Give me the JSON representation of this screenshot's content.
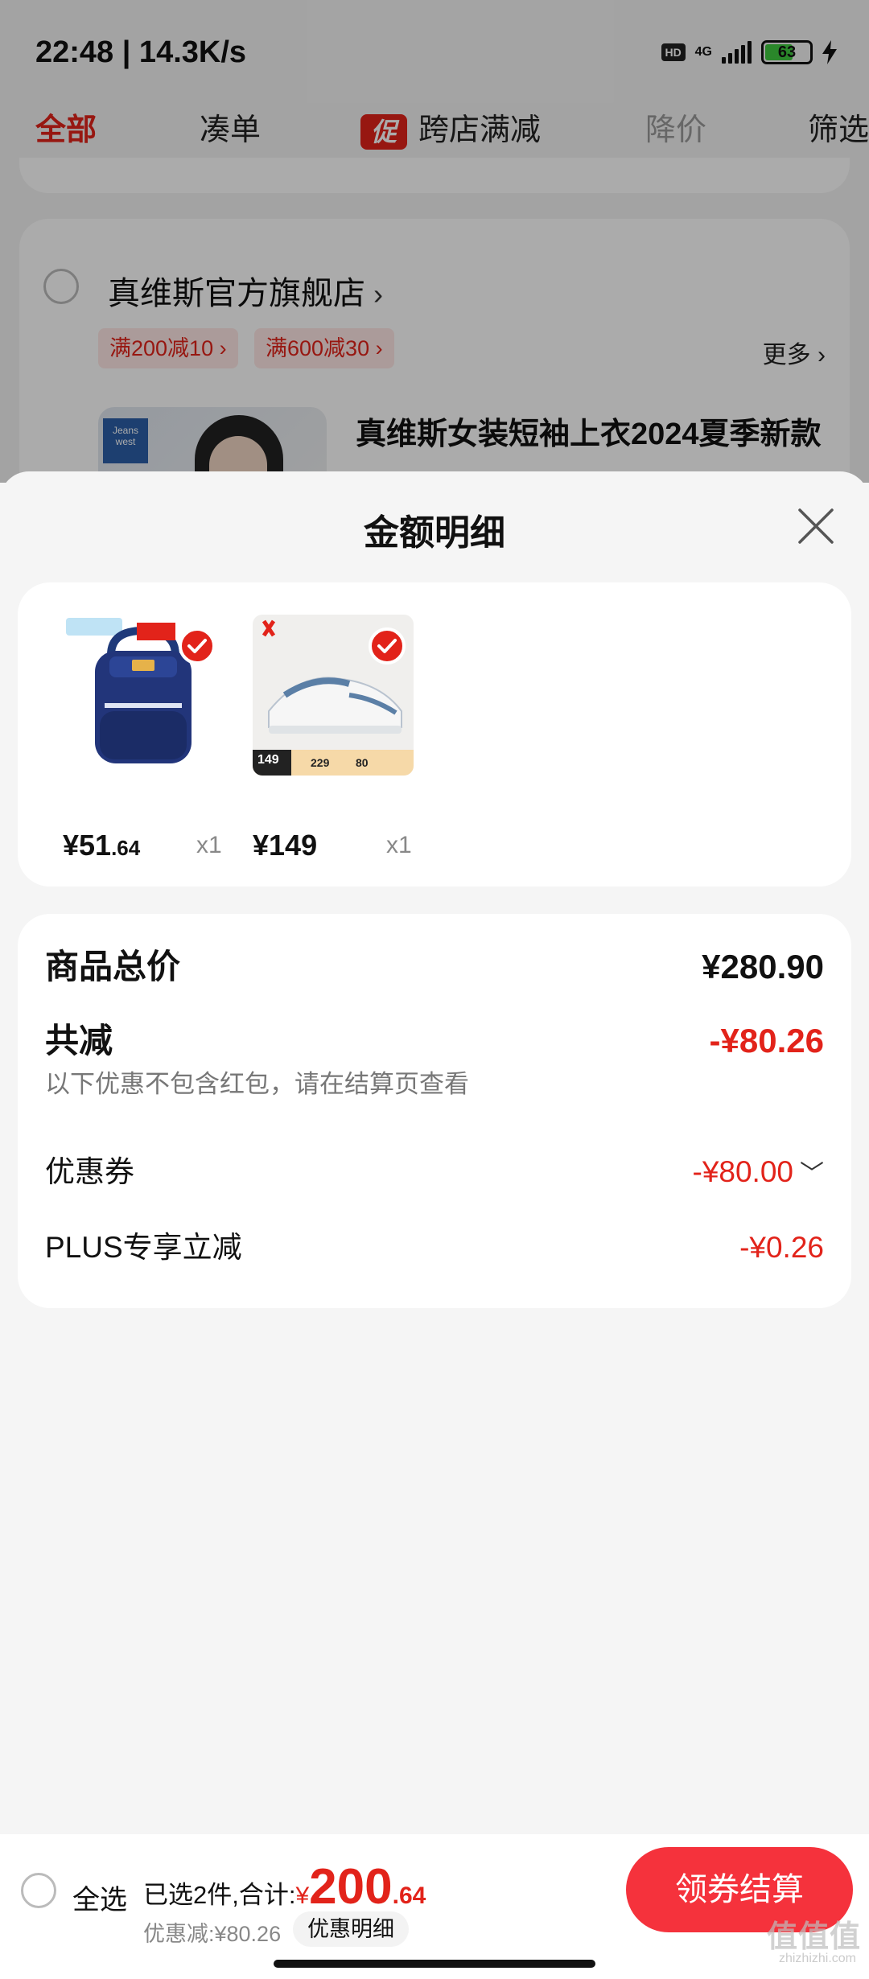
{
  "status_bar": {
    "time": "22:48 | 14.3K/s",
    "hd": "HD",
    "network": "4G",
    "battery": "63"
  },
  "tabs": {
    "all": "全部",
    "combine": "凑单",
    "promo_tag": "促",
    "cross_store": "跨店满减",
    "price_drop": "降价",
    "filter": "筛选"
  },
  "store": {
    "name": "真维斯官方旗舰店",
    "coupons": [
      "满200减10 ›",
      "满600减30 ›"
    ],
    "more": "更多 ›",
    "product_title": "真维斯女装短袖上衣2024夏季新款",
    "logo_text": "Jeans west"
  },
  "sheet": {
    "title": "金额明细",
    "items": [
      {
        "price_int": "¥51",
        "price_dec": ".64",
        "qty": "x1"
      },
      {
        "price_int": "¥149",
        "price_dec": "",
        "qty": "x1",
        "badge_prices": [
          "149",
          "229",
          "80"
        ]
      }
    ],
    "summary": {
      "subtotal_label": "商品总价",
      "subtotal_value": "¥280.90",
      "total_discount_label": "共减",
      "total_discount_value": "-¥80.26",
      "hint": "以下优惠不包含红包，请在结算页查看",
      "coupon_label": "优惠券",
      "coupon_value": "-¥80.00",
      "plus_label": "PLUS专享立减",
      "plus_value": "-¥0.26"
    }
  },
  "bottom_bar": {
    "select_all": "全选",
    "selected_prefix": "已选2件,合计:",
    "yen": "¥",
    "total_int": "200",
    "total_dec": ".64",
    "discount": "优惠减:¥80.26",
    "detail_button": "优惠明细",
    "checkout": "领券结算"
  },
  "watermark": {
    "main": "值值值",
    "sub": "zhizhizhi.com"
  },
  "colors": {
    "accent": "#e2231a",
    "checkout": "#f5323c"
  }
}
